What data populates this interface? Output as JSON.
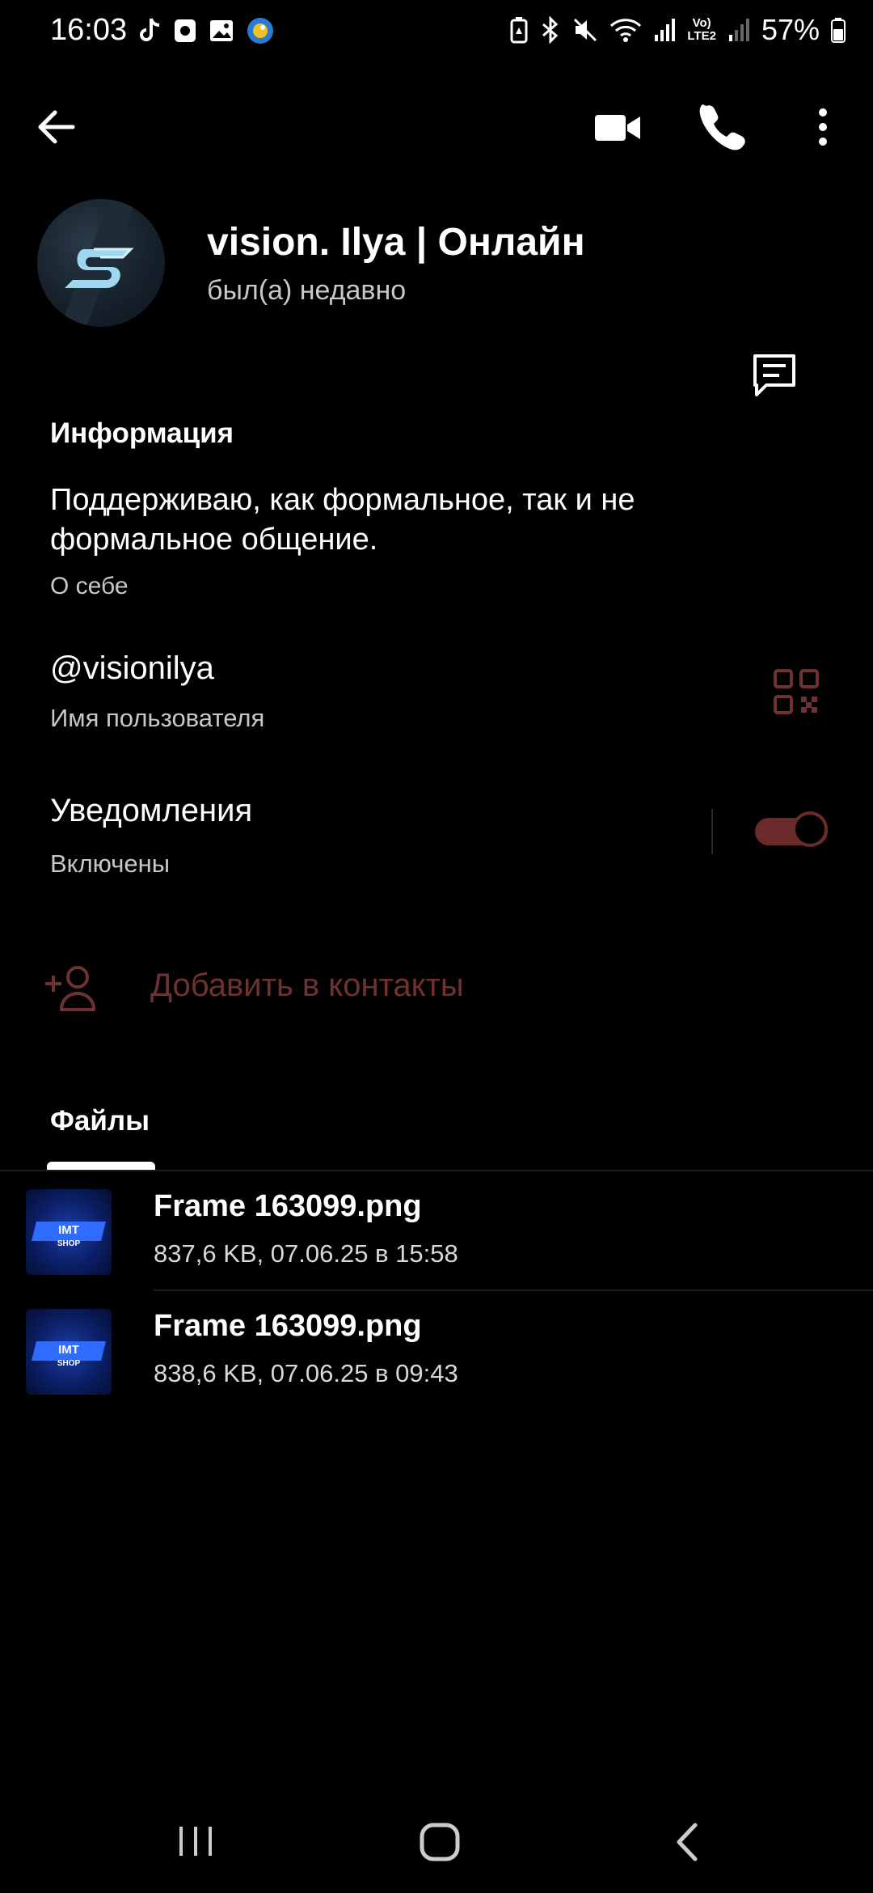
{
  "status_bar": {
    "time": "16:03",
    "battery": "57%",
    "left_icons": [
      "tiktok-icon",
      "camera-app-icon",
      "gallery-icon",
      "game-app-icon"
    ],
    "right_icons": [
      "battery-saver-icon",
      "bluetooth-icon",
      "mute-icon",
      "wifi-icon",
      "signal-icon",
      "volte-lte2-icon",
      "signal-icon",
      "battery-icon"
    ],
    "volte_label": "Vo)",
    "lte_label": "LTE2"
  },
  "top_bar": {
    "icons": [
      "back-arrow-icon",
      "video-call-icon",
      "phone-icon",
      "more-vertical-icon"
    ]
  },
  "profile": {
    "name": "vision. Ilya | Онлайн",
    "status": "был(а) недавно"
  },
  "info": {
    "title": "Информация",
    "bio": "Поддерживаю, как формальное, так и не формальное общение.",
    "bio_label": "О себе",
    "username": "@visionilya",
    "username_label": "Имя пользователя",
    "notifications_title": "Уведомления",
    "notifications_value": "Включены",
    "notifications_on": true,
    "add_contact": "Добавить в контакты"
  },
  "files": {
    "title": "Файлы",
    "items": [
      {
        "name": "Frame 163099.png",
        "meta": "837,6 KB, 07.06.25 в 15:58",
        "thumb_line1": "IMT",
        "thumb_line2": "SHOP"
      },
      {
        "name": "Frame 163099.png",
        "meta": "838,6 KB, 07.06.25 в 09:43",
        "thumb_line1": "IMT",
        "thumb_line2": "SHOP"
      }
    ]
  },
  "nav_bar": {
    "icons": [
      "recent-apps-icon",
      "home-icon",
      "system-back-icon"
    ]
  },
  "colors": {
    "background": "#000000",
    "accent_muted": "#6e3232",
    "toggle_track": "#6b2b2b",
    "secondary_text": "#c8c8c8"
  }
}
